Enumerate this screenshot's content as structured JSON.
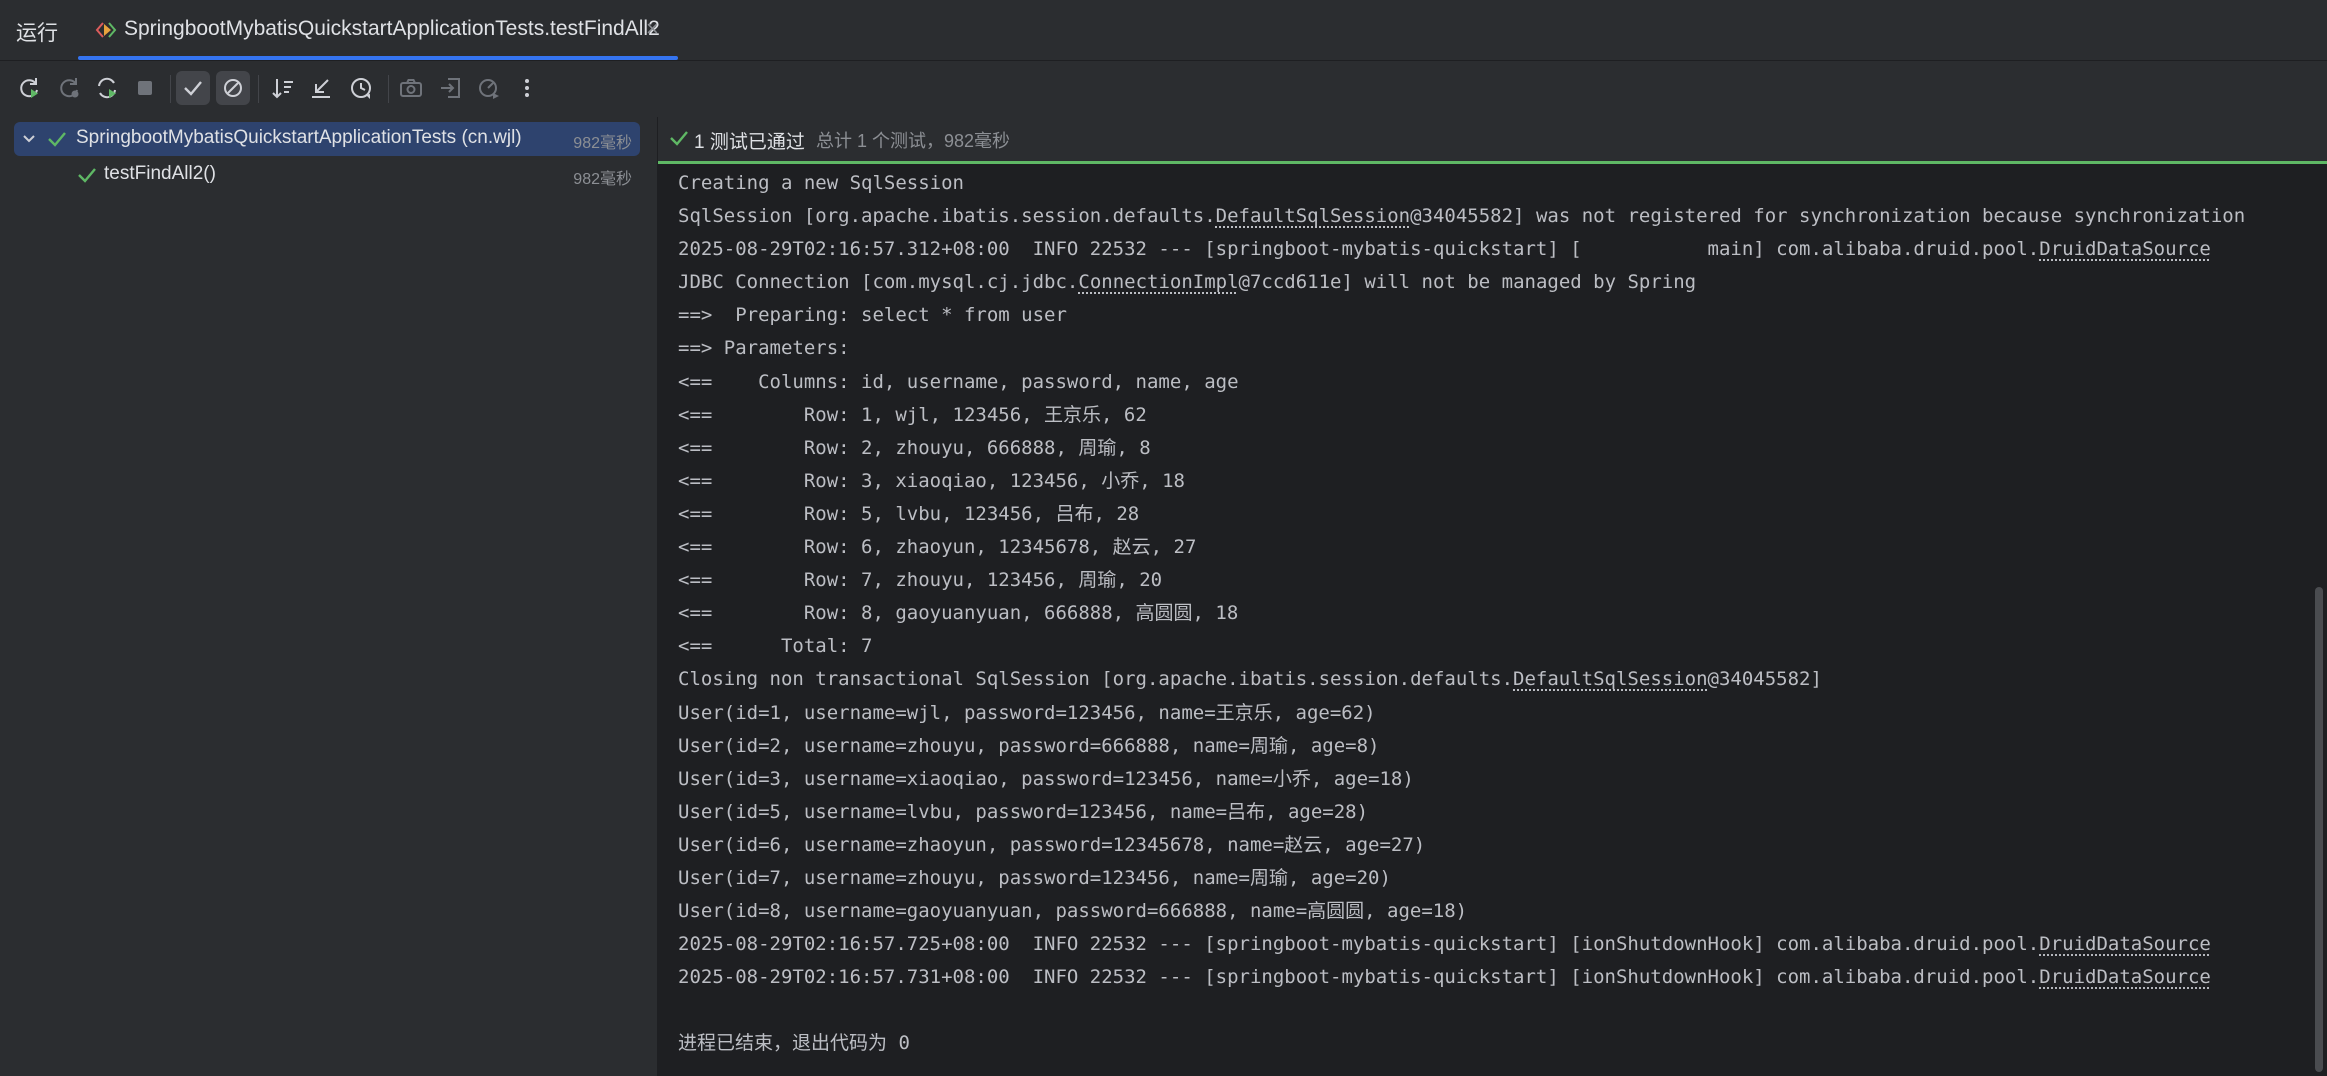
{
  "tabbar": {
    "run_label": "运行",
    "active_tab_title": "SpringbootMybatisQuickstartApplicationTests.testFindAll2",
    "close_glyph": "×"
  },
  "toolbar": {
    "buttons": [
      "rerun-icon",
      "rerun-failed-icon",
      "toggle-auto-test-icon",
      "stop-icon",
      "show-passed-icon",
      "show-ignored-icon",
      "sort-icon",
      "collapse-icon",
      "history-icon",
      "camera-icon",
      "import-icon",
      "export-icon",
      "more-icon"
    ]
  },
  "tree": {
    "root_label": "SpringbootMybatisQuickstartApplicationTests (cn.wjl)",
    "root_time": "982毫秒",
    "child_label": "testFindAll2()",
    "child_time": "982毫秒"
  },
  "status": {
    "passed": "1 测试已通过",
    "summary": "总计 1 个测试，982毫秒"
  },
  "colors": {
    "accent": "#3574f0",
    "pass": "#5fb865",
    "selection": "#2e436e"
  },
  "console_lines": [
    {
      "segments": [
        {
          "t": "Creating a new SqlSession"
        }
      ]
    },
    {
      "segments": [
        {
          "t": "SqlSession [org.apache.ibatis.session.defaults."
        },
        {
          "t": "DefaultSqlSession",
          "u": true
        },
        {
          "t": "@34045582] was not registered for synchronization because synchronization"
        }
      ]
    },
    {
      "segments": [
        {
          "t": "2025-08-29T02:16:57.312+08:00  INFO 22532 --- [springboot-mybatis-quickstart] [           main] com.alibaba.druid.pool."
        },
        {
          "t": "DruidDataSource",
          "u": true
        }
      ]
    },
    {
      "segments": [
        {
          "t": "JDBC Connection [com.mysql.cj.jdbc."
        },
        {
          "t": "ConnectionImpl",
          "u": true
        },
        {
          "t": "@7ccd611e] will not be managed by Spring"
        }
      ]
    },
    {
      "segments": [
        {
          "t": "==>  Preparing: select * from user"
        }
      ]
    },
    {
      "segments": [
        {
          "t": "==> Parameters: "
        }
      ]
    },
    {
      "segments": [
        {
          "t": "<==    Columns: id, username, password, name, age"
        }
      ]
    },
    {
      "segments": [
        {
          "t": "<==        Row: 1, wjl, 123456, 王京乐, 62"
        }
      ]
    },
    {
      "segments": [
        {
          "t": "<==        Row: 2, zhouyu, 666888, 周瑜, 8"
        }
      ]
    },
    {
      "segments": [
        {
          "t": "<==        Row: 3, xiaoqiao, 123456, 小乔, 18"
        }
      ]
    },
    {
      "segments": [
        {
          "t": "<==        Row: 5, lvbu, 123456, 吕布, 28"
        }
      ]
    },
    {
      "segments": [
        {
          "t": "<==        Row: 6, zhaoyun, 12345678, 赵云, 27"
        }
      ]
    },
    {
      "segments": [
        {
          "t": "<==        Row: 7, zhouyu, 123456, 周瑜, 20"
        }
      ]
    },
    {
      "segments": [
        {
          "t": "<==        Row: 8, gaoyuanyuan, 666888, 高圆圆, 18"
        }
      ]
    },
    {
      "segments": [
        {
          "t": "<==      Total: 7"
        }
      ]
    },
    {
      "segments": [
        {
          "t": "Closing non transactional SqlSession [org.apache.ibatis.session.defaults."
        },
        {
          "t": "DefaultSqlSession",
          "u": true
        },
        {
          "t": "@34045582]"
        }
      ]
    },
    {
      "segments": [
        {
          "t": "User(id=1, username=wjl, password=123456, name=王京乐, age=62)"
        }
      ]
    },
    {
      "segments": [
        {
          "t": "User(id=2, username=zhouyu, password=666888, name=周瑜, age=8)"
        }
      ]
    },
    {
      "segments": [
        {
          "t": "User(id=3, username=xiaoqiao, password=123456, name=小乔, age=18)"
        }
      ]
    },
    {
      "segments": [
        {
          "t": "User(id=5, username=lvbu, password=123456, name=吕布, age=28)"
        }
      ]
    },
    {
      "segments": [
        {
          "t": "User(id=6, username=zhaoyun, password=12345678, name=赵云, age=27)"
        }
      ]
    },
    {
      "segments": [
        {
          "t": "User(id=7, username=zhouyu, password=123456, name=周瑜, age=20)"
        }
      ]
    },
    {
      "segments": [
        {
          "t": "User(id=8, username=gaoyuanyuan, password=666888, name=高圆圆, age=18)"
        }
      ]
    },
    {
      "segments": [
        {
          "t": "2025-08-29T02:16:57.725+08:00  INFO 22532 --- [springboot-mybatis-quickstart] [ionShutdownHook] com.alibaba.druid.pool."
        },
        {
          "t": "DruidDataSource",
          "u": true
        }
      ]
    },
    {
      "segments": [
        {
          "t": "2025-08-29T02:16:57.731+08:00  INFO 22532 --- [springboot-mybatis-quickstart] [ionShutdownHook] com.alibaba.druid.pool."
        },
        {
          "t": "DruidDataSource",
          "u": true
        }
      ]
    },
    {
      "segments": [
        {
          "t": ""
        }
      ]
    },
    {
      "segments": [
        {
          "t": "进程已结束，退出代码为 0"
        }
      ]
    }
  ]
}
